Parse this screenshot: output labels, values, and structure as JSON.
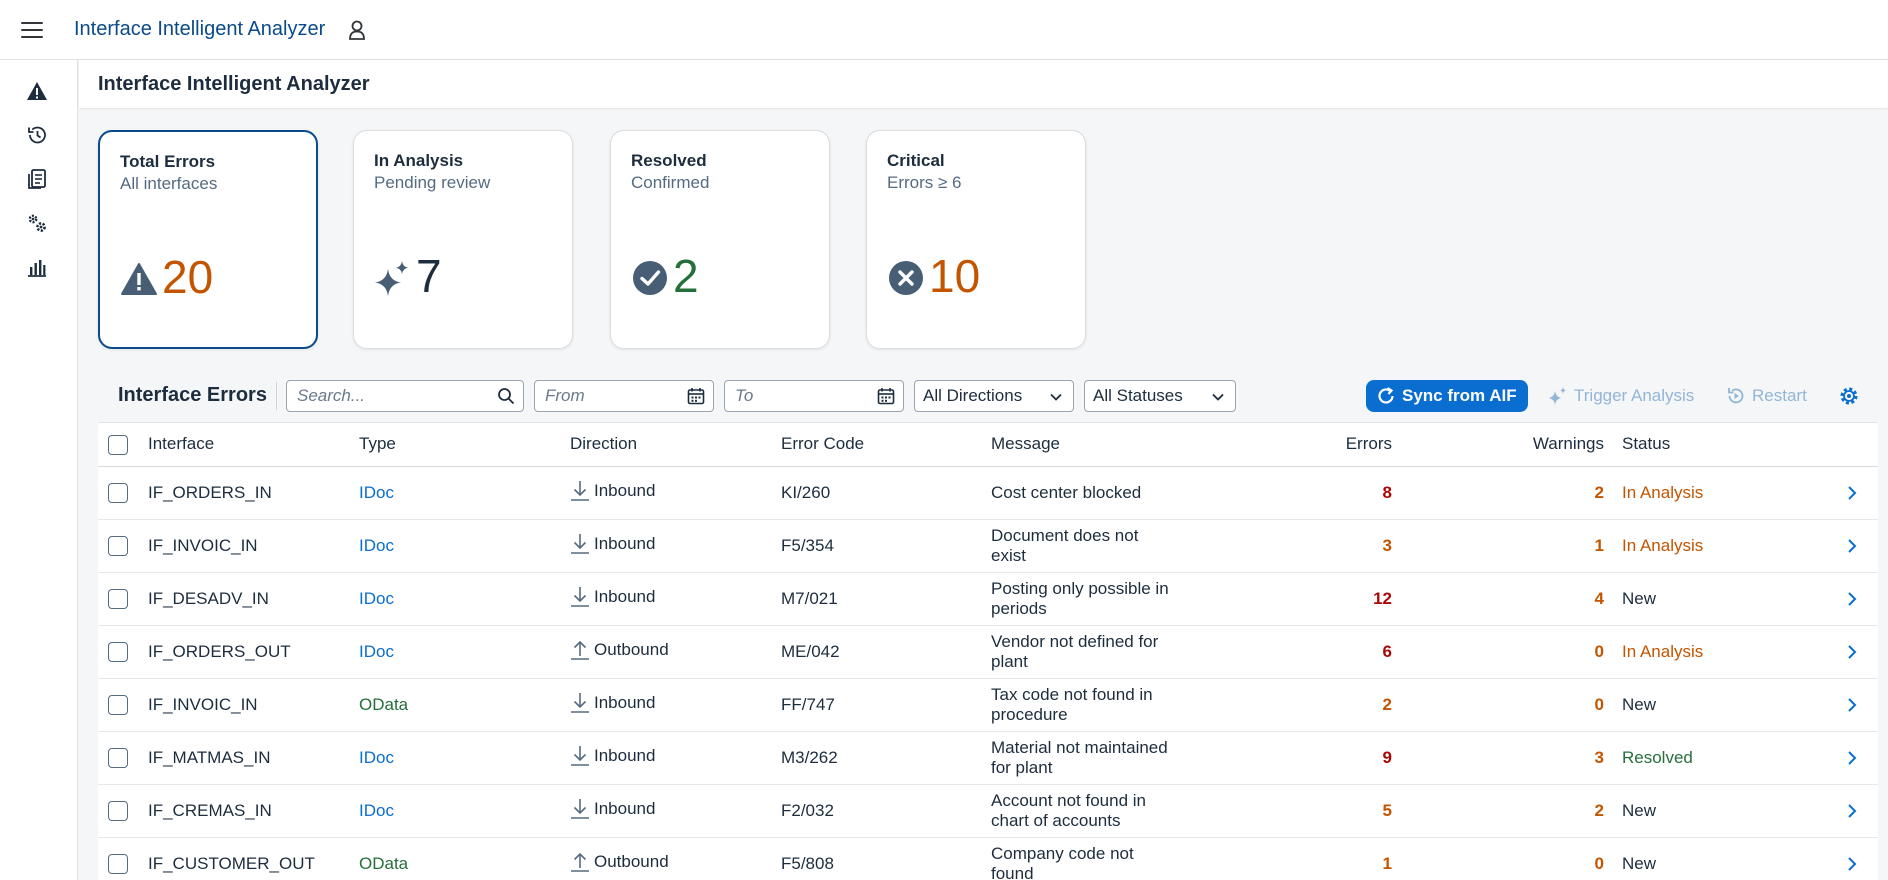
{
  "shell": {
    "app_title": "Interface Intelligent Analyzer"
  },
  "sidenav": {
    "items": [
      "alert-icon",
      "history-icon",
      "documents-icon",
      "settings-icon",
      "chart-icon"
    ]
  },
  "page": {
    "title": "Interface Intelligent Analyzer"
  },
  "tiles": [
    {
      "title": "Total Errors",
      "subtitle": "All interfaces",
      "value": "20",
      "icon": "warning-icon",
      "color": "#c35500"
    },
    {
      "title": "In Analysis",
      "subtitle": "Pending review",
      "value": "7",
      "icon": "sparkle-icon",
      "color": "#1d2d3e"
    },
    {
      "title": "Resolved",
      "subtitle": "Confirmed",
      "value": "2",
      "icon": "check-circle-icon",
      "color": "#256f3a"
    },
    {
      "title": "Critical",
      "subtitle": "Errors ≥ 6",
      "value": "10",
      "icon": "cancel-circle-icon",
      "color": "#c35500"
    }
  ],
  "toolbar": {
    "title": "Interface Errors",
    "search_placeholder": "Search...",
    "from_placeholder": "From",
    "to_placeholder": "To",
    "direction_selected": "All Directions",
    "status_selected": "All Statuses",
    "sync_label": "Sync from AIF",
    "trigger_label": "Trigger Analysis",
    "restart_label": "Restart"
  },
  "table": {
    "headers": [
      "Interface",
      "Type",
      "Direction",
      "Error Code",
      "Message",
      "Errors",
      "Warnings",
      "Status"
    ],
    "rows": [
      {
        "interface": "IF_ORDERS_IN",
        "type": "IDoc",
        "direction": "Inbound",
        "code": "KI/260",
        "message": [
          "Cost center blocked"
        ],
        "errors": "8",
        "warnings": "2",
        "status": "In Analysis"
      },
      {
        "interface": "IF_INVOIC_IN",
        "type": "IDoc",
        "direction": "Inbound",
        "code": "F5/354",
        "message": [
          "Document does not",
          "exist"
        ],
        "errors": "3",
        "warnings": "1",
        "status": "In Analysis"
      },
      {
        "interface": "IF_DESADV_IN",
        "type": "IDoc",
        "direction": "Inbound",
        "code": "M7/021",
        "message": [
          "Posting only possible in",
          "periods"
        ],
        "errors": "12",
        "warnings": "4",
        "status": "New"
      },
      {
        "interface": "IF_ORDERS_OUT",
        "type": "IDoc",
        "direction": "Outbound",
        "code": "ME/042",
        "message": [
          "Vendor not defined for",
          "plant"
        ],
        "errors": "6",
        "warnings": "0",
        "status": "In Analysis"
      },
      {
        "interface": "IF_INVOIC_IN",
        "type": "OData",
        "direction": "Inbound",
        "code": "FF/747",
        "message": [
          "Tax code not found in",
          "procedure"
        ],
        "errors": "2",
        "warnings": "0",
        "status": "New"
      },
      {
        "interface": "IF_MATMAS_IN",
        "type": "IDoc",
        "direction": "Inbound",
        "code": "M3/262",
        "message": [
          "Material not maintained",
          "for plant"
        ],
        "errors": "9",
        "warnings": "3",
        "status": "Resolved"
      },
      {
        "interface": "IF_CREMAS_IN",
        "type": "IDoc",
        "direction": "Inbound",
        "code": "F2/032",
        "message": [
          "Account not found in",
          "chart of accounts"
        ],
        "errors": "5",
        "warnings": "2",
        "status": "New"
      },
      {
        "interface": "IF_CUSTOMER_OUT",
        "type": "OData",
        "direction": "Outbound",
        "code": "F5/808",
        "message": [
          "Company code not",
          "found"
        ],
        "errors": "1",
        "warnings": "0",
        "status": "New"
      }
    ]
  },
  "colors": {
    "idoc": "#0a6ed1",
    "odata": "#256f3a",
    "critical": "#aa0808",
    "warning": "#c35500",
    "resolved": "#256f3a",
    "neutral": "#1d2d3e",
    "link": "#0a6ed1"
  }
}
